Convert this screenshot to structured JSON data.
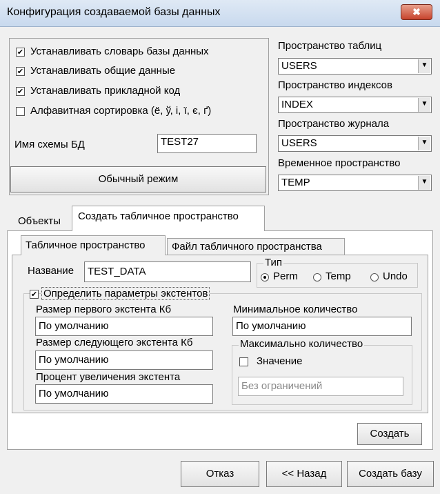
{
  "window": {
    "title": "Конфигурация создаваемой базы данных",
    "close_glyph": "✖"
  },
  "options": {
    "checkboxes": [
      {
        "label": "Устанавливать словарь базы данных",
        "checked": true
      },
      {
        "label": "Устанавливать общие данные",
        "checked": true
      },
      {
        "label": "Устанавливать прикладной код",
        "checked": true
      },
      {
        "label": "Алфавитная сортировка (ё, ў, і, ї, є, ґ)",
        "checked": false
      }
    ],
    "schema_label": "Имя схемы БД",
    "schema_value": "TEST27",
    "mode_button": "Обычный режим"
  },
  "spaces": {
    "tables_label": "Пространство таблиц",
    "tables_value": "USERS",
    "index_label": "Пространство индексов",
    "index_value": "INDEX",
    "journal_label": "Пространство журнала",
    "journal_value": "USERS",
    "temp_label": "Временное пространство",
    "temp_value": "TEMP"
  },
  "outer_tabs": [
    {
      "label": "Объекты",
      "active": false
    },
    {
      "label": "Создать табличное пространство",
      "active": true
    }
  ],
  "inner_tabs": [
    {
      "label": "Табличное пространство",
      "active": true
    },
    {
      "label": "Файл табличного пространства",
      "active": false
    }
  ],
  "tablespace": {
    "name_label": "Название",
    "name_value": "TEST_DATA",
    "type_group": "Тип",
    "types": [
      {
        "label": "Perm",
        "selected": true
      },
      {
        "label": "Temp",
        "selected": false
      },
      {
        "label": "Undo",
        "selected": false
      }
    ],
    "extents_checkbox": "Определить параметры экстентов",
    "extents_checked": true,
    "first_extent_label": "Размер первого экстента Кб",
    "first_extent_value": "По умолчанию",
    "next_extent_label": "Размер следующего экстента Кб",
    "next_extent_value": "По умолчанию",
    "increase_label": "Процент увеличения экстента",
    "increase_value": "По умолчанию",
    "min_count_label": "Минимальное количество",
    "min_count_value": "По умолчанию",
    "max_group": "Максимально количество",
    "max_value_checkbox": "Значение",
    "max_value_checked": false,
    "max_placeholder": "Без ограничений",
    "create_button": "Создать"
  },
  "footer": {
    "cancel": "Отказ",
    "back": "<< Назад",
    "create_db": "Создать базу"
  }
}
